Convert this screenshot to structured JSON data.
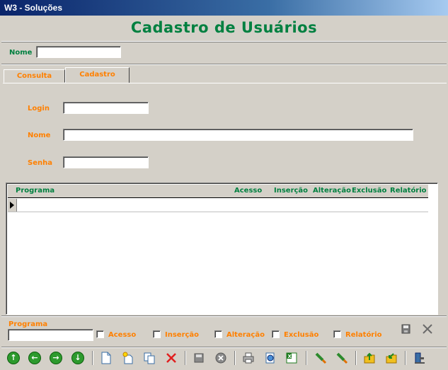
{
  "window": {
    "title": "W3 - Soluções"
  },
  "header": {
    "title": "Cadastro de Usuários"
  },
  "top_filter": {
    "nome_label": "Nome",
    "nome_value": ""
  },
  "tabs": [
    {
      "label": "Consulta",
      "active": false
    },
    {
      "label": "Cadastro",
      "active": true
    }
  ],
  "form": {
    "login_label": "Login",
    "login_value": "",
    "nome_label": "Nome",
    "nome_value": "",
    "senha_label": "Senha",
    "senha_value": ""
  },
  "grid": {
    "columns": [
      "Programa",
      "Acesso",
      "Inserção",
      "Alteração",
      "Exclusão",
      "Relatório"
    ],
    "rows": [
      {
        "programa": "",
        "acesso": "",
        "insercao": "",
        "alteracao": "",
        "exclusao": "",
        "relatorio": ""
      }
    ]
  },
  "editor": {
    "programa_label": "Programa",
    "programa_value": "",
    "checks": [
      {
        "label": "Acesso",
        "checked": false
      },
      {
        "label": "Inserção",
        "checked": false
      },
      {
        "label": "Alteração",
        "checked": false
      },
      {
        "label": "Exclusão",
        "checked": false
      },
      {
        "label": "Relatório",
        "checked": false
      }
    ]
  },
  "toolbar": {
    "icons": [
      "first-record-icon",
      "previous-record-icon",
      "next-record-icon",
      "last-record-icon",
      "new-document-icon",
      "new-copy-icon",
      "copy-icon",
      "delete-icon",
      "save-icon",
      "cancel-icon",
      "print-icon",
      "preview-icon",
      "excel-icon",
      "pen-edit-icon",
      "pen-clear-icon",
      "export-folder-icon",
      "import-folder-icon",
      "exit-icon"
    ]
  },
  "colors": {
    "label_green": "#008040",
    "label_orange": "#ff8000",
    "window_bg": "#d4d0c8",
    "title_bar": "#0a246a"
  }
}
